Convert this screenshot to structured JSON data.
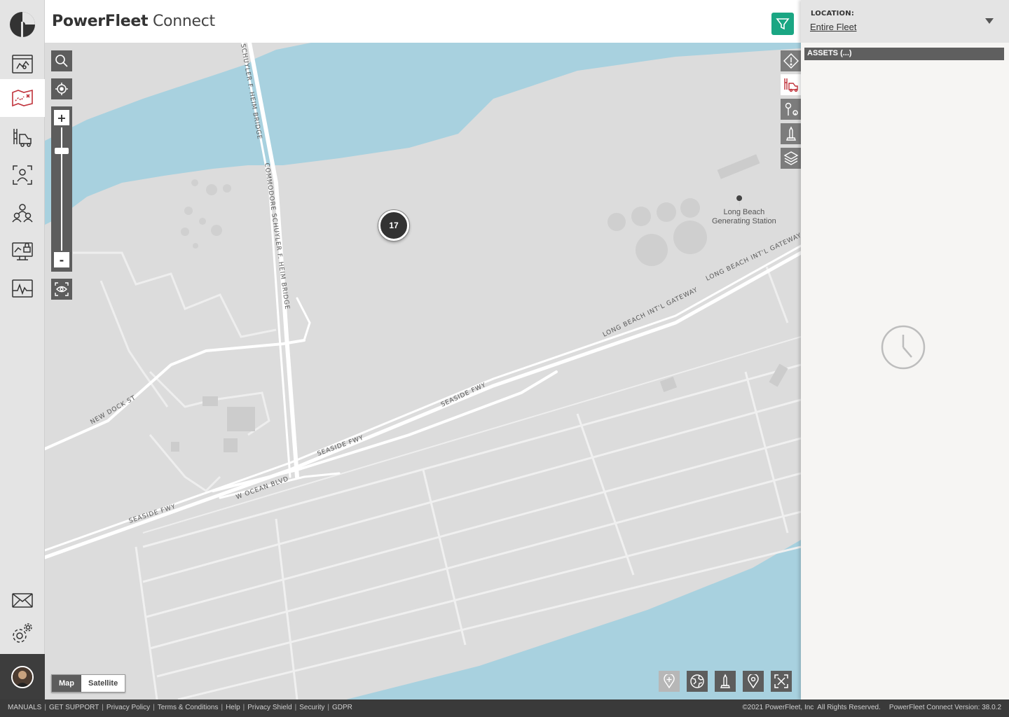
{
  "app": {
    "brand_bold": "PowerFleet",
    "brand_light": "Connect"
  },
  "nav": {
    "items": [
      {
        "name": "dashboard-icon"
      },
      {
        "name": "map-icon",
        "active": true
      },
      {
        "name": "assets-icon"
      },
      {
        "name": "drivers-icon"
      },
      {
        "name": "users-icon"
      },
      {
        "name": "security-icon"
      },
      {
        "name": "reports-icon"
      }
    ],
    "bottom": [
      {
        "name": "messages-icon"
      },
      {
        "name": "settings-icon"
      }
    ]
  },
  "colors": {
    "accent": "#1aa683",
    "active_red": "#c0313a",
    "water": "#a8d1df",
    "land": "#dcdcdc",
    "dark": "#5d5d5d"
  },
  "location": {
    "label": "LOCATION:",
    "value": "Entire Fleet"
  },
  "assets": {
    "header": "ASSETS (...)"
  },
  "map": {
    "cluster_count": "17",
    "poi": {
      "name_line1": "Long Beach",
      "name_line2": "Generating Station"
    },
    "road_labels": {
      "bridge_1": "SCHUYLER F. HEIM BRIDGE",
      "bridge_2": "COMMODORE SCHUYLER F. HEIM BRIDGE",
      "gateway_1": "LONG BEACH INT'L GATEWAY",
      "gateway_2": "LONG BEACH INT'L GATEWAY",
      "seaside_1": "SEASIDE FWY",
      "seaside_2": "SEASIDE FWY",
      "seaside_3": "SEASIDE FWY",
      "ocean": "W OCEAN BLVD",
      "dock": "NEW DOCK ST"
    },
    "zoom_in": "+",
    "zoom_out": "-",
    "type_map": "Map",
    "type_satellite": "Satellite"
  },
  "footer": {
    "links": [
      "MANUALS",
      "GET SUPPORT",
      "Privacy Policy",
      "Terms & Conditions",
      "Help",
      "Privacy Shield",
      "Security",
      "GDPR"
    ],
    "copyright": "©2021 PowerFleet, Inc  All Rights Reserved.",
    "version": "PowerFleet Connect Version: 38.0.2"
  }
}
